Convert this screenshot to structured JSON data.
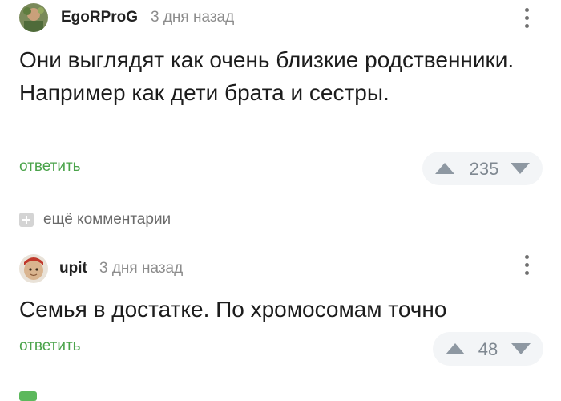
{
  "comments": [
    {
      "username": "EgoRProG",
      "time": "3 дня назад",
      "text": "Они выглядят как очень близкие родственники. Например как дети брата и сестры.",
      "reply_label": "ответить",
      "score": "235"
    },
    {
      "username": "upit",
      "time": "3 дня назад",
      "text": "Семья в достатке. По хромосомам точно",
      "reply_label": "ответить",
      "score": "48"
    }
  ],
  "more_comments": {
    "label": "ещё комментарии"
  },
  "colors": {
    "accent_green": "#4aa34a",
    "muted_gray": "#8c8c8c",
    "vote_bg": "#f3f5f7",
    "vote_arrow": "#8e98a2"
  },
  "icons": [
    "user-avatar",
    "kebab-menu-icon",
    "upvote-arrow-icon",
    "downvote-arrow-icon",
    "plus-icon"
  ]
}
